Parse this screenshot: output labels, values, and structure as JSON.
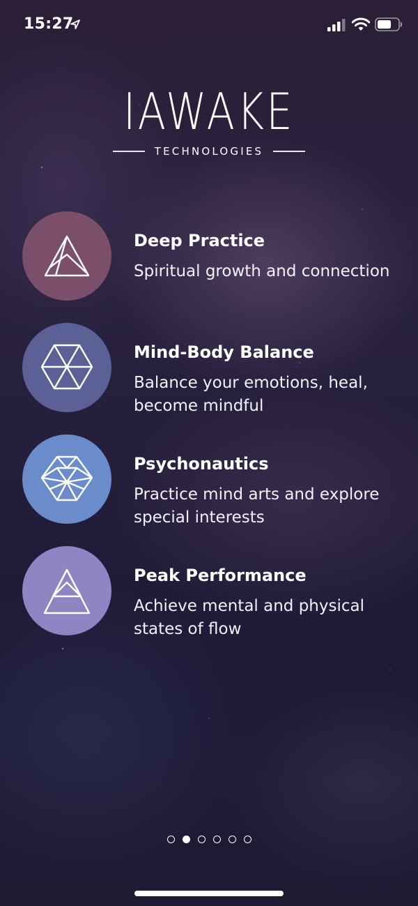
{
  "status_bar": {
    "time": "15:27",
    "icons": [
      "location-arrow-icon",
      "cellular-signal-icon",
      "wifi-icon",
      "battery-icon"
    ]
  },
  "logo": {
    "name": "IAWAKE",
    "subtitle": "TECHNOLOGIES"
  },
  "features": [
    {
      "title": "Deep Practice",
      "description": "Spiritual growth and connection",
      "icon": "triangle-icon",
      "color": "#7b4e6a"
    },
    {
      "title": "Mind-Body Balance",
      "description": "Balance your emotions, heal, become mindful",
      "icon": "hexagon-icon",
      "color": "#5b6196"
    },
    {
      "title": "Psychonautics",
      "description": "Practice mind arts and explore special interests",
      "icon": "crystal-icon",
      "color": "#6a8ccb"
    },
    {
      "title": "Peak Performance",
      "description": "Achieve mental and physical states of flow",
      "icon": "nested-triangle-icon",
      "color": "#8e86c2"
    }
  ],
  "pagination": {
    "total": 6,
    "active_index": 1
  }
}
